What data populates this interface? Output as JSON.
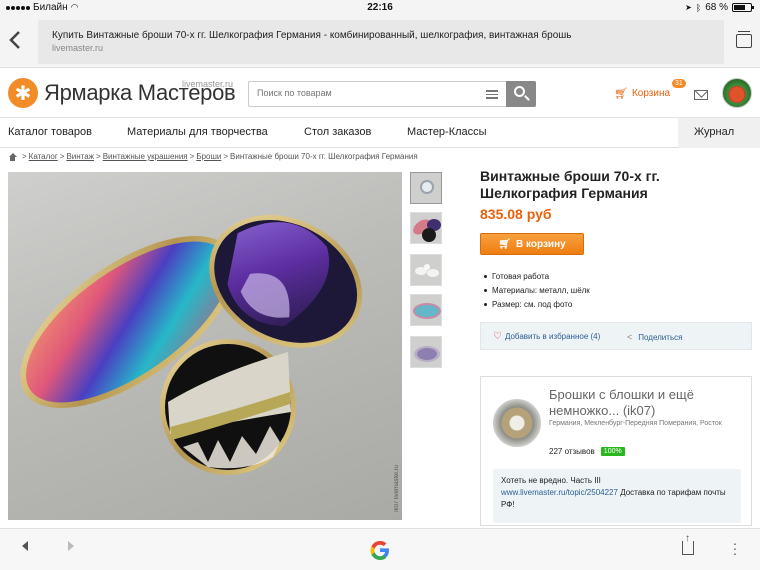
{
  "status_bar": {
    "carrier": "Билайн",
    "time": "22:16",
    "battery": "68 %",
    "battery_level": 0.68
  },
  "browser": {
    "page_title": "Купить Винтажные броши 70-х гг. Шелкография Германия - комбинированный, шелкография, винтажная брошь",
    "domain": "livemaster.ru"
  },
  "header": {
    "logo_name": "Ярмарка Мастеров",
    "logo_sub": "livemaster.ru",
    "search_placeholder": "Поиск по товарам",
    "cart_label": "Корзина",
    "cart_count": "31"
  },
  "nav": {
    "items": [
      "Каталог товаров",
      "Материалы для творчества",
      "Стол заказов",
      "Мастер-Классы",
      "Журнал"
    ]
  },
  "breadcrumb": {
    "items": [
      "Каталог",
      "Винтаж",
      "Винтажные украшения",
      "Броши"
    ],
    "separator": ">",
    "current": "Винтажные броши 70-х гг. Шелкография Германия"
  },
  "photo": {
    "watermark": "ik07 livemaster.ru"
  },
  "product": {
    "title": "Винтажные броши 70-х гг. Шелкография Германия",
    "price": "835.08 руб",
    "buy_label": "В корзину",
    "features": [
      "Готовая работа",
      "Материалы: металл, шёлк",
      "Размер: см. под фото"
    ],
    "favorite_label": "Добавить в избранное (4)",
    "share_label": "Поделиться"
  },
  "shop": {
    "name": "Брошки с блошки и ещё немножко... (ik07)",
    "location": "Германия, Мекленбург-Передняя Померания, Росток",
    "reviews": "227 отзывов",
    "rating": "100%",
    "post_title": "Хотеть не вредно. Часть III",
    "post_link": "www.livemaster.ru/topic/2504227",
    "post_text": "Доставка по тарифам почты РФ!"
  },
  "colors": {
    "accent": "#f28c28",
    "price": "#e8620c",
    "link": "#2a5f96",
    "rating": "#2bb51f"
  },
  "icons": {
    "back": "chevron-left-icon",
    "tabs": "tabs-icon",
    "search": "search-icon",
    "cart": "cart-icon",
    "mail": "mail-icon",
    "heart": "heart-icon",
    "share": "share-icon",
    "google": "google-icon",
    "more": "more-vertical-icon"
  }
}
